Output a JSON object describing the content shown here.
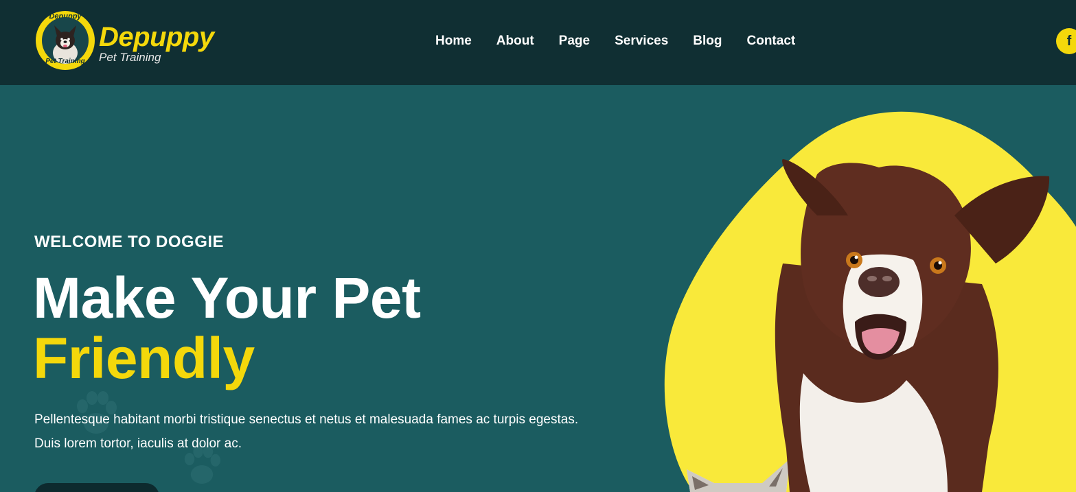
{
  "header": {
    "logo": {
      "badge_top": "Depuppy",
      "badge_bottom": "Pet Training",
      "name": "Depuppy",
      "subtitle": "Pet Training"
    },
    "nav": [
      {
        "label": "Home"
      },
      {
        "label": "About"
      },
      {
        "label": "Page"
      },
      {
        "label": "Services"
      },
      {
        "label": "Blog"
      },
      {
        "label": "Contact"
      }
    ],
    "social": {
      "facebook_glyph": "f",
      "icon": "facebook-icon"
    }
  },
  "hero": {
    "eyebrow": "WELCOME TO DOGGIE",
    "headline_line1": "Make Your Pet",
    "headline_line2": "Friendly",
    "description": "Pellentesque habitant morbi tristique senectus et netus et malesuada fames ac turpis egestas. Duis lorem tortor, iaculis at dolor ac.",
    "cta_label": ""
  },
  "colors": {
    "header_bg": "#102f33",
    "hero_bg": "#1b5c60",
    "accent_yellow": "#f4d80b",
    "text_white": "#ffffff"
  }
}
